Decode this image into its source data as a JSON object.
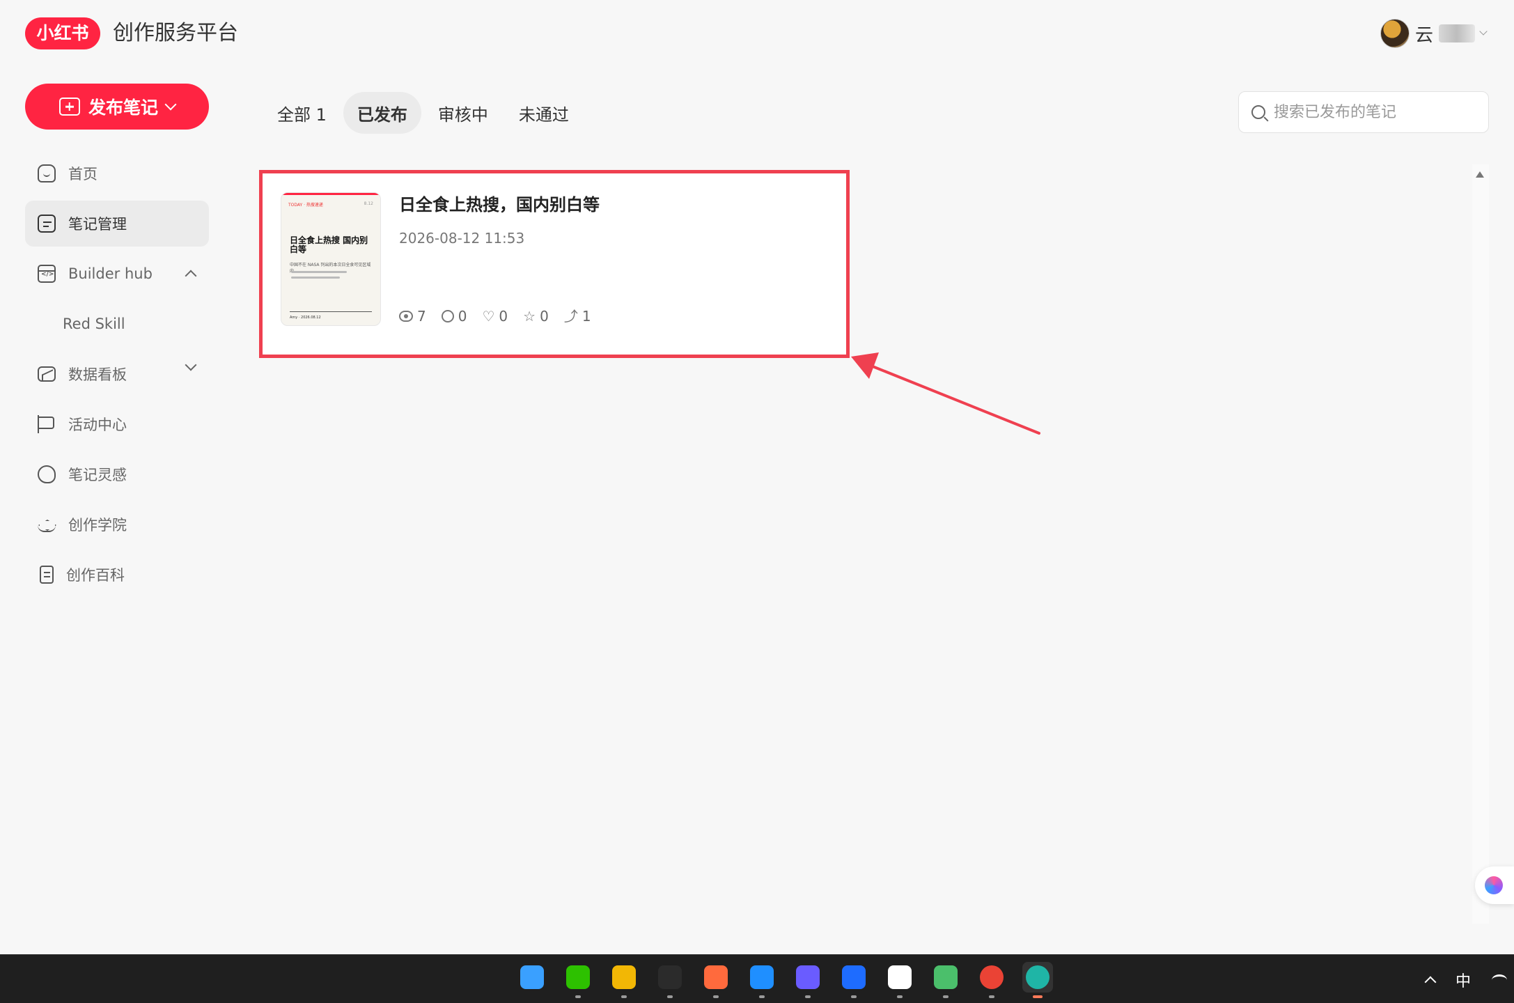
{
  "header": {
    "logo_text": "小红书",
    "platform_title": "创作服务平台",
    "user_name": "云"
  },
  "sidebar": {
    "publish_label": "发布笔记",
    "items": [
      {
        "label": "首页",
        "icon": "home-icon"
      },
      {
        "label": "笔记管理",
        "icon": "note-icon",
        "active": true
      },
      {
        "label": "Builder hub",
        "icon": "code-icon",
        "expanded": true
      },
      {
        "label": "Red Skill",
        "sub": true
      },
      {
        "label": "数据看板",
        "icon": "chart-icon",
        "expanded": false
      },
      {
        "label": "活动中心",
        "icon": "flag-icon"
      },
      {
        "label": "笔记灵感",
        "icon": "bulb-icon"
      },
      {
        "label": "创作学院",
        "icon": "graduation-cap-icon"
      },
      {
        "label": "创作百科",
        "icon": "book-icon"
      }
    ]
  },
  "tabs": [
    {
      "label": "全部 1"
    },
    {
      "label": "已发布",
      "active": true
    },
    {
      "label": "审核中"
    },
    {
      "label": "未通过"
    }
  ],
  "search": {
    "placeholder": "搜索已发布的笔记"
  },
  "note": {
    "title": "日全食上热搜，国内别白等",
    "time": "2026-08-12 11:53",
    "stats": {
      "views": "7",
      "comments": "0",
      "likes": "0",
      "collects": "0",
      "shares": "1"
    },
    "thumbnail": {
      "brand": "TODAY · 热搜速递",
      "date_tag": "8.12",
      "title": "日全食上热搜 国内别白等",
      "subtitle": "中国不在 NASA 列出的本次日全食可见区域内。",
      "footer_left": "Amy · 2026.08.12"
    }
  },
  "taskbar": {
    "apps": [
      {
        "name": "windows-start-icon",
        "color": "#3aa0ff"
      },
      {
        "name": "wechat-icon",
        "color": "#2dc100"
      },
      {
        "name": "file-explorer-icon",
        "color": "#f2b705"
      },
      {
        "name": "terminal-icon",
        "color": "#2b2b2b"
      },
      {
        "name": "lobster-app-icon",
        "color": "#ff6a3d"
      },
      {
        "name": "search-app-icon",
        "color": "#1f8fff"
      },
      {
        "name": "feather-app-icon",
        "color": "#6a5cff"
      },
      {
        "name": "shield-app-icon",
        "color": "#1e6cff"
      },
      {
        "name": "qq-icon",
        "color": "#ffffff"
      },
      {
        "name": "recycle-bin-icon",
        "color": "#4bbf6b"
      },
      {
        "name": "chrome-icon",
        "color": "#ea4335"
      },
      {
        "name": "edge-icon",
        "color": "#1fb5a6"
      }
    ],
    "ime_label": "中"
  },
  "colors": {
    "brand": "#ff2442",
    "highlight": "#ef4050"
  }
}
